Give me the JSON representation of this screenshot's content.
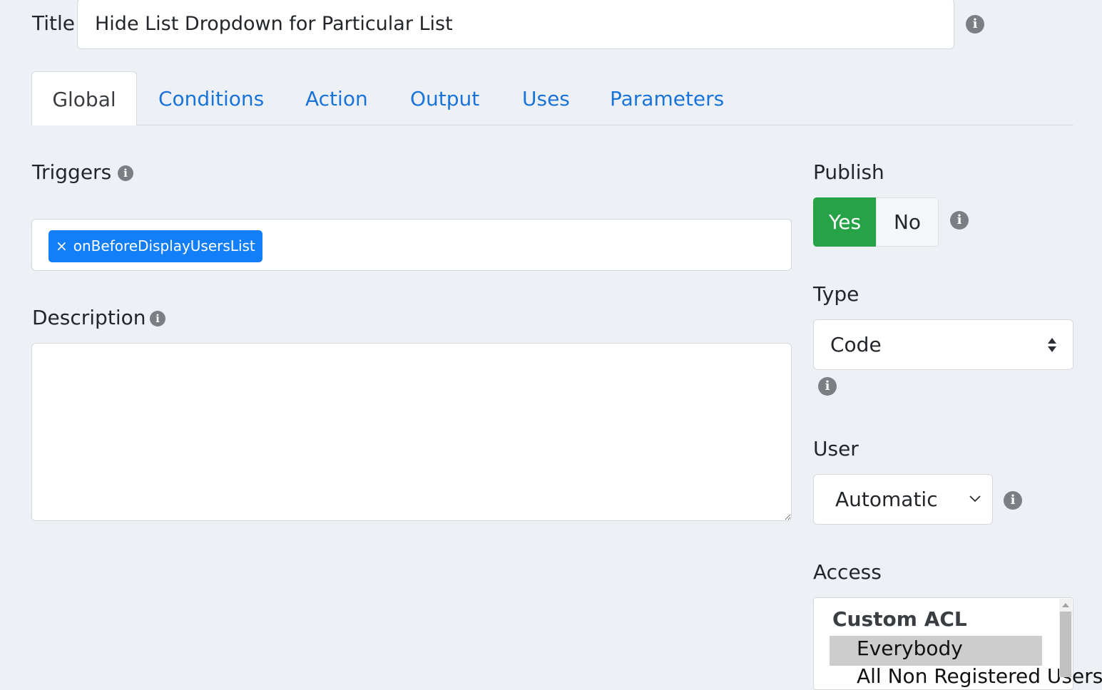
{
  "form": {
    "title_label": "Title",
    "title_value": "Hide List Dropdown for Particular List"
  },
  "tabs": [
    {
      "label": "Global",
      "active": true
    },
    {
      "label": "Conditions"
    },
    {
      "label": "Action"
    },
    {
      "label": "Output"
    },
    {
      "label": "Uses"
    },
    {
      "label": "Parameters"
    }
  ],
  "triggers": {
    "label": "Triggers",
    "tags": [
      {
        "remove": "×",
        "label": "onBeforeDisplayUsersList"
      }
    ]
  },
  "description": {
    "label": "Description",
    "value": ""
  },
  "publish": {
    "label": "Publish",
    "yes": "Yes",
    "no": "No",
    "selected": "Yes"
  },
  "type": {
    "label": "Type",
    "value": "Code"
  },
  "user": {
    "label": "User",
    "value": "Automatic"
  },
  "access": {
    "label": "Access",
    "group": "Custom ACL",
    "options": [
      "Everybody",
      "All Non Registered Users"
    ],
    "selected": "Everybody"
  },
  "icons": {
    "info": "info-icon",
    "tag_color": "#127ef8",
    "publish_yes_color": "#26a346",
    "tab_link_color": "#1a73d9"
  }
}
